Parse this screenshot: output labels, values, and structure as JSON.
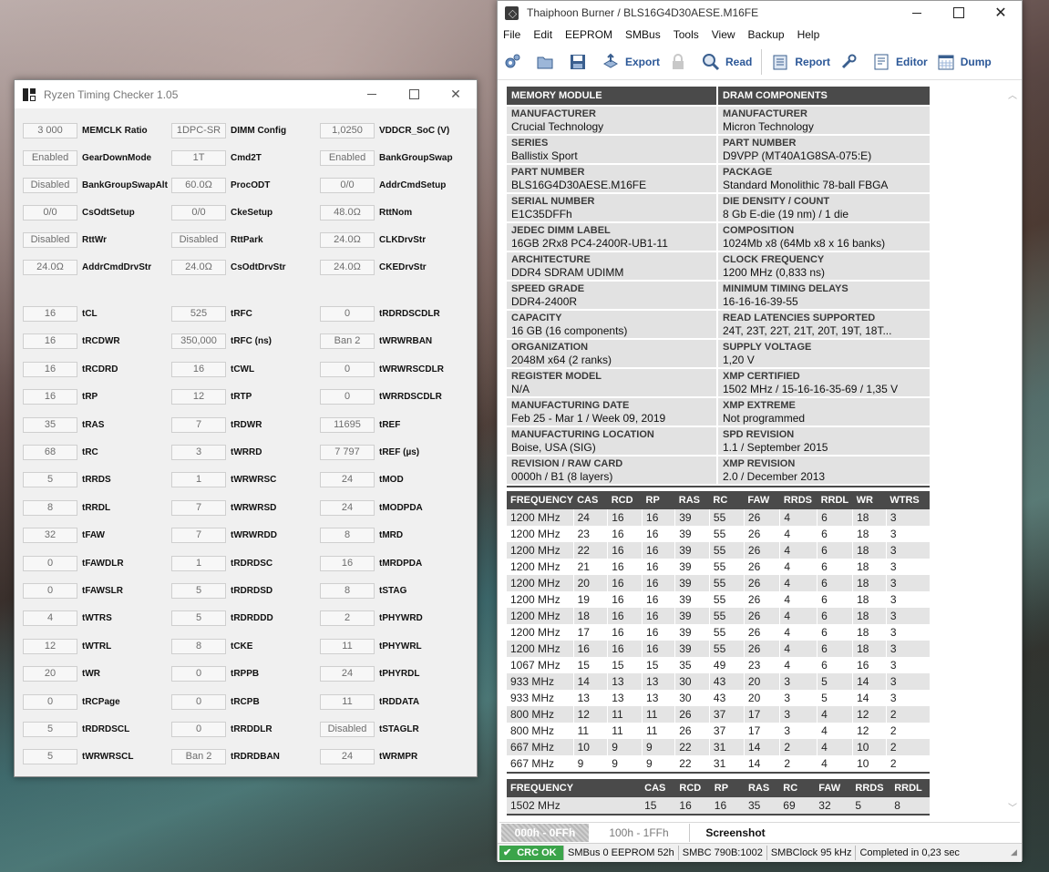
{
  "rtc": {
    "title": "Ryzen Timing Checker 1.05",
    "top_rows": [
      [
        {
          "v": "3 000",
          "l": "MEMCLK Ratio"
        },
        {
          "v": "1DPC-SR",
          "l": "DIMM Config"
        },
        {
          "v": "1,0250",
          "l": "VDDCR_SoC (V)"
        }
      ],
      [
        {
          "v": "Enabled",
          "l": "GearDownMode"
        },
        {
          "v": "1T",
          "l": "Cmd2T"
        },
        {
          "v": "Enabled",
          "l": "BankGroupSwap"
        }
      ],
      [
        {
          "v": "Disabled",
          "l": "BankGroupSwapAlt"
        },
        {
          "v": "60.0Ω",
          "l": "ProcODT"
        },
        {
          "v": "0/0",
          "l": "AddrCmdSetup"
        }
      ],
      [
        {
          "v": "0/0",
          "l": "CsOdtSetup"
        },
        {
          "v": "0/0",
          "l": "CkeSetup"
        },
        {
          "v": "48.0Ω",
          "l": "RttNom"
        }
      ],
      [
        {
          "v": "Disabled",
          "l": "RttWr"
        },
        {
          "v": "Disabled",
          "l": "RttPark"
        },
        {
          "v": "24.0Ω",
          "l": "CLKDrvStr"
        }
      ],
      [
        {
          "v": "24.0Ω",
          "l": "AddrCmdDrvStr"
        },
        {
          "v": "24.0Ω",
          "l": "CsOdtDrvStr"
        },
        {
          "v": "24.0Ω",
          "l": "CKEDrvStr"
        }
      ]
    ],
    "timing_rows": [
      [
        {
          "v": "16",
          "l": "tCL"
        },
        {
          "v": "525",
          "l": "tRFC"
        },
        {
          "v": "0",
          "l": "tRDRDSCDLR"
        }
      ],
      [
        {
          "v": "16",
          "l": "tRCDWR"
        },
        {
          "v": "350,000",
          "l": "tRFC (ns)"
        },
        {
          "v": "Ban 2",
          "l": "tWRWRBAN"
        }
      ],
      [
        {
          "v": "16",
          "l": "tRCDRD"
        },
        {
          "v": "16",
          "l": "tCWL"
        },
        {
          "v": "0",
          "l": "tWRWRSCDLR"
        }
      ],
      [
        {
          "v": "16",
          "l": "tRP"
        },
        {
          "v": "12",
          "l": "tRTP"
        },
        {
          "v": "0",
          "l": "tWRRDSCDLR"
        }
      ],
      [
        {
          "v": "35",
          "l": "tRAS"
        },
        {
          "v": "7",
          "l": "tRDWR"
        },
        {
          "v": "11695",
          "l": "tREF"
        }
      ],
      [
        {
          "v": "68",
          "l": "tRC"
        },
        {
          "v": "3",
          "l": "tWRRD"
        },
        {
          "v": "7 797",
          "l": "tREF (µs)"
        }
      ],
      [
        {
          "v": "5",
          "l": "tRRDS"
        },
        {
          "v": "1",
          "l": "tWRWRSC"
        },
        {
          "v": "24",
          "l": "tMOD"
        }
      ],
      [
        {
          "v": "8",
          "l": "tRRDL"
        },
        {
          "v": "7",
          "l": "tWRWRSD"
        },
        {
          "v": "24",
          "l": "tMODPDA"
        }
      ],
      [
        {
          "v": "32",
          "l": "tFAW"
        },
        {
          "v": "7",
          "l": "tWRWRDD"
        },
        {
          "v": "8",
          "l": "tMRD"
        }
      ],
      [
        {
          "v": "0",
          "l": "tFAWDLR"
        },
        {
          "v": "1",
          "l": "tRDRDSC"
        },
        {
          "v": "16",
          "l": "tMRDPDA"
        }
      ],
      [
        {
          "v": "0",
          "l": "tFAWSLR"
        },
        {
          "v": "5",
          "l": "tRDRDSD"
        },
        {
          "v": "8",
          "l": "tSTAG"
        }
      ],
      [
        {
          "v": "4",
          "l": "tWTRS"
        },
        {
          "v": "5",
          "l": "tRDRDDD"
        },
        {
          "v": "2",
          "l": "tPHYWRD"
        }
      ],
      [
        {
          "v": "12",
          "l": "tWTRL"
        },
        {
          "v": "8",
          "l": "tCKE"
        },
        {
          "v": "11",
          "l": "tPHYWRL"
        }
      ],
      [
        {
          "v": "20",
          "l": "tWR"
        },
        {
          "v": "0",
          "l": "tRPPB"
        },
        {
          "v": "24",
          "l": "tPHYRDL"
        }
      ],
      [
        {
          "v": "0",
          "l": "tRCPage"
        },
        {
          "v": "0",
          "l": "tRCPB"
        },
        {
          "v": "11",
          "l": "tRDDATA"
        }
      ],
      [
        {
          "v": "5",
          "l": "tRDRDSCL"
        },
        {
          "v": "0",
          "l": "tRRDDLR"
        },
        {
          "v": "Disabled",
          "l": "tSTAGLR"
        }
      ],
      [
        {
          "v": "5",
          "l": "tWRWRSCL"
        },
        {
          "v": "Ban 2",
          "l": "tRDRDBAN"
        },
        {
          "v": "24",
          "l": "tWRMPR"
        }
      ]
    ]
  },
  "tb": {
    "title": "Thaiphoon Burner / BLS16G4D30AESE.M16FE",
    "menu": [
      "File",
      "Edit",
      "EEPROM",
      "SMBus",
      "Tools",
      "View",
      "Backup",
      "Help"
    ],
    "toolbar": {
      "export": "Export",
      "read": "Read",
      "report": "Report",
      "editor": "Editor",
      "dump": "Dump"
    },
    "headers": {
      "left": "MEMORY MODULE",
      "right": "DRAM COMPONENTS"
    },
    "spd_rows": [
      [
        {
          "k": "MANUFACTURER",
          "v": "Crucial Technology"
        },
        {
          "k": "MANUFACTURER",
          "v": "Micron Technology"
        }
      ],
      [
        {
          "k": "SERIES",
          "v": "Ballistix Sport"
        },
        {
          "k": "PART NUMBER",
          "v": "D9VPP (MT40A1G8SA-075:E)"
        }
      ],
      [
        {
          "k": "PART NUMBER",
          "v": "BLS16G4D30AESE.M16FE"
        },
        {
          "k": "PACKAGE",
          "v": "Standard Monolithic 78-ball FBGA"
        }
      ],
      [
        {
          "k": "SERIAL NUMBER",
          "v": "E1C35DFFh"
        },
        {
          "k": "DIE DENSITY / COUNT",
          "v": "8 Gb E-die (19 nm) / 1 die"
        }
      ],
      [
        {
          "k": "JEDEC DIMM LABEL",
          "v": "16GB 2Rx8 PC4-2400R-UB1-11"
        },
        {
          "k": "COMPOSITION",
          "v": "1024Mb x8 (64Mb x8 x 16 banks)"
        }
      ],
      [
        {
          "k": "ARCHITECTURE",
          "v": "DDR4 SDRAM UDIMM"
        },
        {
          "k": "CLOCK FREQUENCY",
          "v": "1200 MHz (0,833 ns)"
        }
      ],
      [
        {
          "k": "SPEED GRADE",
          "v": "DDR4-2400R"
        },
        {
          "k": "MINIMUM TIMING DELAYS",
          "v": "16-16-16-39-55"
        }
      ],
      [
        {
          "k": "CAPACITY",
          "v": "16 GB (16 components)"
        },
        {
          "k": "READ LATENCIES SUPPORTED",
          "v": "24T, 23T, 22T, 21T, 20T, 19T, 18T..."
        }
      ],
      [
        {
          "k": "ORGANIZATION",
          "v": "2048M x64 (2 ranks)"
        },
        {
          "k": "SUPPLY VOLTAGE",
          "v": "1,20 V"
        }
      ],
      [
        {
          "k": "REGISTER MODEL",
          "v": "N/A"
        },
        {
          "k": "XMP CERTIFIED",
          "v": "1502 MHz / 15-16-16-35-69 / 1,35 V"
        }
      ],
      [
        {
          "k": "MANUFACTURING DATE",
          "v": "Feb 25 - Mar 1 / Week 09, 2019"
        },
        {
          "k": "XMP EXTREME",
          "v": "Not programmed"
        }
      ],
      [
        {
          "k": "MANUFACTURING LOCATION",
          "v": "Boise, USA (SIG)"
        },
        {
          "k": "SPD REVISION",
          "v": "1.1 / September 2015"
        }
      ],
      [
        {
          "k": "REVISION / RAW CARD",
          "v": "0000h / B1 (8 layers)"
        },
        {
          "k": "XMP REVISION",
          "v": "2.0 / December 2013"
        }
      ]
    ],
    "timing_headers": [
      "FREQUENCY",
      "CAS",
      "RCD",
      "RP",
      "RAS",
      "RC",
      "FAW",
      "RRDS",
      "RRDL",
      "WR",
      "WTRS"
    ],
    "timing_rows": [
      [
        "1200 MHz",
        "24",
        "16",
        "16",
        "39",
        "55",
        "26",
        "4",
        "6",
        "18",
        "3"
      ],
      [
        "1200 MHz",
        "23",
        "16",
        "16",
        "39",
        "55",
        "26",
        "4",
        "6",
        "18",
        "3"
      ],
      [
        "1200 MHz",
        "22",
        "16",
        "16",
        "39",
        "55",
        "26",
        "4",
        "6",
        "18",
        "3"
      ],
      [
        "1200 MHz",
        "21",
        "16",
        "16",
        "39",
        "55",
        "26",
        "4",
        "6",
        "18",
        "3"
      ],
      [
        "1200 MHz",
        "20",
        "16",
        "16",
        "39",
        "55",
        "26",
        "4",
        "6",
        "18",
        "3"
      ],
      [
        "1200 MHz",
        "19",
        "16",
        "16",
        "39",
        "55",
        "26",
        "4",
        "6",
        "18",
        "3"
      ],
      [
        "1200 MHz",
        "18",
        "16",
        "16",
        "39",
        "55",
        "26",
        "4",
        "6",
        "18",
        "3"
      ],
      [
        "1200 MHz",
        "17",
        "16",
        "16",
        "39",
        "55",
        "26",
        "4",
        "6",
        "18",
        "3"
      ],
      [
        "1200 MHz",
        "16",
        "16",
        "16",
        "39",
        "55",
        "26",
        "4",
        "6",
        "18",
        "3"
      ],
      [
        "1067 MHz",
        "15",
        "15",
        "15",
        "35",
        "49",
        "23",
        "4",
        "6",
        "16",
        "3"
      ],
      [
        "933 MHz",
        "14",
        "13",
        "13",
        "30",
        "43",
        "20",
        "3",
        "5",
        "14",
        "3"
      ],
      [
        "933 MHz",
        "13",
        "13",
        "13",
        "30",
        "43",
        "20",
        "3",
        "5",
        "14",
        "3"
      ],
      [
        "800 MHz",
        "12",
        "11",
        "11",
        "26",
        "37",
        "17",
        "3",
        "4",
        "12",
        "2"
      ],
      [
        "800 MHz",
        "11",
        "11",
        "11",
        "26",
        "37",
        "17",
        "3",
        "4",
        "12",
        "2"
      ],
      [
        "667 MHz",
        "10",
        "9",
        "9",
        "22",
        "31",
        "14",
        "2",
        "4",
        "10",
        "2"
      ],
      [
        "667 MHz",
        "9",
        "9",
        "9",
        "22",
        "31",
        "14",
        "2",
        "4",
        "10",
        "2"
      ]
    ],
    "xmp_headers": [
      "FREQUENCY",
      "",
      "CAS",
      "RCD",
      "RP",
      "RAS",
      "RC",
      "FAW",
      "RRDS",
      "RRDL"
    ],
    "xmp_row": [
      "1502 MHz",
      "",
      "15",
      "16",
      "16",
      "35",
      "69",
      "32",
      "5",
      "8"
    ],
    "tabs": {
      "a": "000h - 0FFh",
      "b": "100h - 1FFh",
      "c": "Screenshot"
    },
    "status": {
      "crc": "CRC OK",
      "smbus": "SMBus 0 EEPROM 52h",
      "smbc": "SMBC 790B:1002",
      "clock": "SMBClock 95 kHz",
      "done": "Completed in 0,23 sec"
    }
  }
}
